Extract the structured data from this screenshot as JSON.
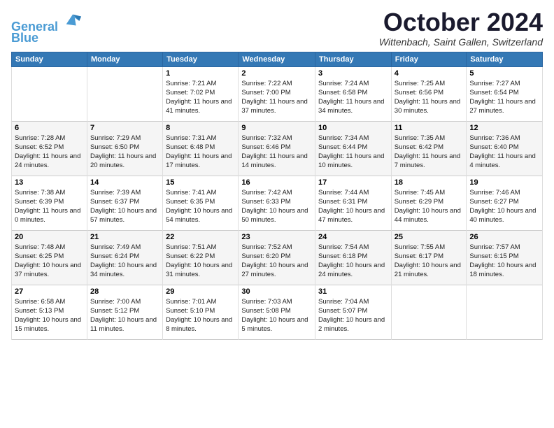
{
  "header": {
    "logo_line1": "General",
    "logo_line2": "Blue",
    "month": "October 2024",
    "location": "Wittenbach, Saint Gallen, Switzerland"
  },
  "columns": [
    "Sunday",
    "Monday",
    "Tuesday",
    "Wednesday",
    "Thursday",
    "Friday",
    "Saturday"
  ],
  "weeks": [
    [
      {
        "day": "",
        "sunrise": "",
        "sunset": "",
        "daylight": ""
      },
      {
        "day": "",
        "sunrise": "",
        "sunset": "",
        "daylight": ""
      },
      {
        "day": "1",
        "sunrise": "Sunrise: 7:21 AM",
        "sunset": "Sunset: 7:02 PM",
        "daylight": "Daylight: 11 hours and 41 minutes."
      },
      {
        "day": "2",
        "sunrise": "Sunrise: 7:22 AM",
        "sunset": "Sunset: 7:00 PM",
        "daylight": "Daylight: 11 hours and 37 minutes."
      },
      {
        "day": "3",
        "sunrise": "Sunrise: 7:24 AM",
        "sunset": "Sunset: 6:58 PM",
        "daylight": "Daylight: 11 hours and 34 minutes."
      },
      {
        "day": "4",
        "sunrise": "Sunrise: 7:25 AM",
        "sunset": "Sunset: 6:56 PM",
        "daylight": "Daylight: 11 hours and 30 minutes."
      },
      {
        "day": "5",
        "sunrise": "Sunrise: 7:27 AM",
        "sunset": "Sunset: 6:54 PM",
        "daylight": "Daylight: 11 hours and 27 minutes."
      }
    ],
    [
      {
        "day": "6",
        "sunrise": "Sunrise: 7:28 AM",
        "sunset": "Sunset: 6:52 PM",
        "daylight": "Daylight: 11 hours and 24 minutes."
      },
      {
        "day": "7",
        "sunrise": "Sunrise: 7:29 AM",
        "sunset": "Sunset: 6:50 PM",
        "daylight": "Daylight: 11 hours and 20 minutes."
      },
      {
        "day": "8",
        "sunrise": "Sunrise: 7:31 AM",
        "sunset": "Sunset: 6:48 PM",
        "daylight": "Daylight: 11 hours and 17 minutes."
      },
      {
        "day": "9",
        "sunrise": "Sunrise: 7:32 AM",
        "sunset": "Sunset: 6:46 PM",
        "daylight": "Daylight: 11 hours and 14 minutes."
      },
      {
        "day": "10",
        "sunrise": "Sunrise: 7:34 AM",
        "sunset": "Sunset: 6:44 PM",
        "daylight": "Daylight: 11 hours and 10 minutes."
      },
      {
        "day": "11",
        "sunrise": "Sunrise: 7:35 AM",
        "sunset": "Sunset: 6:42 PM",
        "daylight": "Daylight: 11 hours and 7 minutes."
      },
      {
        "day": "12",
        "sunrise": "Sunrise: 7:36 AM",
        "sunset": "Sunset: 6:40 PM",
        "daylight": "Daylight: 11 hours and 4 minutes."
      }
    ],
    [
      {
        "day": "13",
        "sunrise": "Sunrise: 7:38 AM",
        "sunset": "Sunset: 6:39 PM",
        "daylight": "Daylight: 11 hours and 0 minutes."
      },
      {
        "day": "14",
        "sunrise": "Sunrise: 7:39 AM",
        "sunset": "Sunset: 6:37 PM",
        "daylight": "Daylight: 10 hours and 57 minutes."
      },
      {
        "day": "15",
        "sunrise": "Sunrise: 7:41 AM",
        "sunset": "Sunset: 6:35 PM",
        "daylight": "Daylight: 10 hours and 54 minutes."
      },
      {
        "day": "16",
        "sunrise": "Sunrise: 7:42 AM",
        "sunset": "Sunset: 6:33 PM",
        "daylight": "Daylight: 10 hours and 50 minutes."
      },
      {
        "day": "17",
        "sunrise": "Sunrise: 7:44 AM",
        "sunset": "Sunset: 6:31 PM",
        "daylight": "Daylight: 10 hours and 47 minutes."
      },
      {
        "day": "18",
        "sunrise": "Sunrise: 7:45 AM",
        "sunset": "Sunset: 6:29 PM",
        "daylight": "Daylight: 10 hours and 44 minutes."
      },
      {
        "day": "19",
        "sunrise": "Sunrise: 7:46 AM",
        "sunset": "Sunset: 6:27 PM",
        "daylight": "Daylight: 10 hours and 40 minutes."
      }
    ],
    [
      {
        "day": "20",
        "sunrise": "Sunrise: 7:48 AM",
        "sunset": "Sunset: 6:25 PM",
        "daylight": "Daylight: 10 hours and 37 minutes."
      },
      {
        "day": "21",
        "sunrise": "Sunrise: 7:49 AM",
        "sunset": "Sunset: 6:24 PM",
        "daylight": "Daylight: 10 hours and 34 minutes."
      },
      {
        "day": "22",
        "sunrise": "Sunrise: 7:51 AM",
        "sunset": "Sunset: 6:22 PM",
        "daylight": "Daylight: 10 hours and 31 minutes."
      },
      {
        "day": "23",
        "sunrise": "Sunrise: 7:52 AM",
        "sunset": "Sunset: 6:20 PM",
        "daylight": "Daylight: 10 hours and 27 minutes."
      },
      {
        "day": "24",
        "sunrise": "Sunrise: 7:54 AM",
        "sunset": "Sunset: 6:18 PM",
        "daylight": "Daylight: 10 hours and 24 minutes."
      },
      {
        "day": "25",
        "sunrise": "Sunrise: 7:55 AM",
        "sunset": "Sunset: 6:17 PM",
        "daylight": "Daylight: 10 hours and 21 minutes."
      },
      {
        "day": "26",
        "sunrise": "Sunrise: 7:57 AM",
        "sunset": "Sunset: 6:15 PM",
        "daylight": "Daylight: 10 hours and 18 minutes."
      }
    ],
    [
      {
        "day": "27",
        "sunrise": "Sunrise: 6:58 AM",
        "sunset": "Sunset: 5:13 PM",
        "daylight": "Daylight: 10 hours and 15 minutes."
      },
      {
        "day": "28",
        "sunrise": "Sunrise: 7:00 AM",
        "sunset": "Sunset: 5:12 PM",
        "daylight": "Daylight: 10 hours and 11 minutes."
      },
      {
        "day": "29",
        "sunrise": "Sunrise: 7:01 AM",
        "sunset": "Sunset: 5:10 PM",
        "daylight": "Daylight: 10 hours and 8 minutes."
      },
      {
        "day": "30",
        "sunrise": "Sunrise: 7:03 AM",
        "sunset": "Sunset: 5:08 PM",
        "daylight": "Daylight: 10 hours and 5 minutes."
      },
      {
        "day": "31",
        "sunrise": "Sunrise: 7:04 AM",
        "sunset": "Sunset: 5:07 PM",
        "daylight": "Daylight: 10 hours and 2 minutes."
      },
      {
        "day": "",
        "sunrise": "",
        "sunset": "",
        "daylight": ""
      },
      {
        "day": "",
        "sunrise": "",
        "sunset": "",
        "daylight": ""
      }
    ]
  ]
}
